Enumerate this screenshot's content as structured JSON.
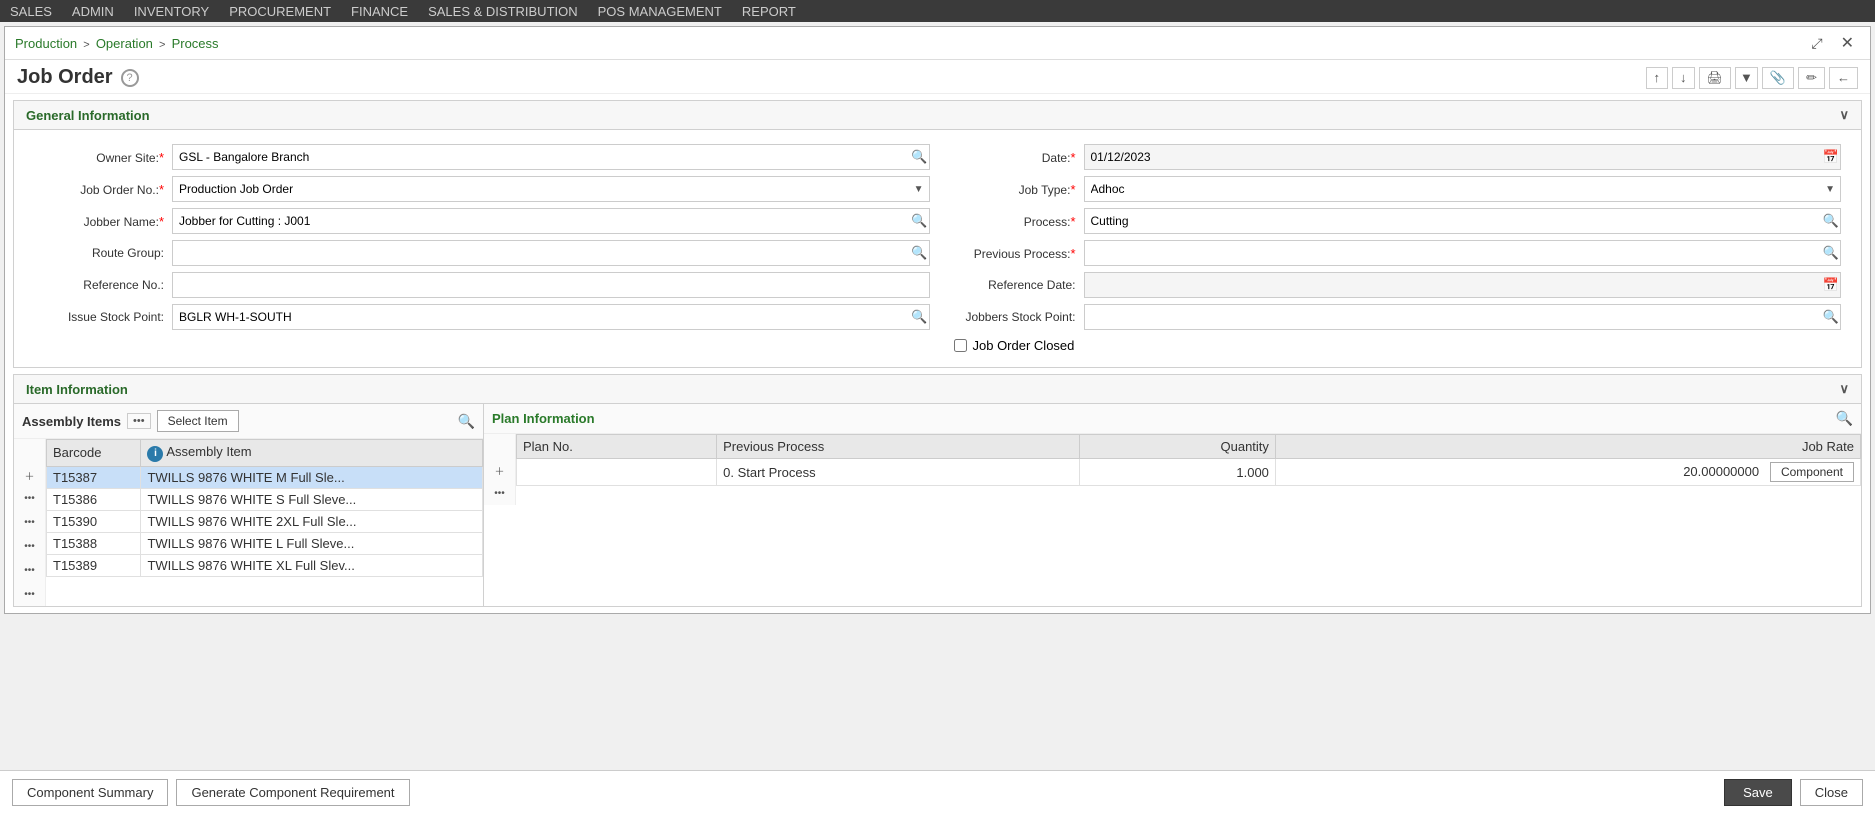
{
  "nav": {
    "items": [
      "SALES",
      "ADMIN",
      "INVENTORY",
      "PROCUREMENT",
      "FINANCE",
      "SALES & DISTRIBUTION",
      "POS MANAGEMENT",
      "REPORT"
    ]
  },
  "breadcrumb": {
    "parts": [
      "Production",
      "Operation",
      "Process"
    ]
  },
  "window": {
    "title": "Job Order",
    "page_title": "Production Job Order"
  },
  "toolbar": {
    "icons": [
      "↕",
      "↕",
      "🖨",
      "▼",
      "📎",
      "✏",
      "←"
    ]
  },
  "general_info": {
    "label": "General Information",
    "fields": {
      "owner_site": {
        "label": "Owner Site:",
        "value": "GSL - Bangalore Branch",
        "required": true
      },
      "job_order_no": {
        "label": "Job Order No.:",
        "value": "Production Job Order",
        "required": true
      },
      "jobber_name": {
        "label": "Jobber Name:",
        "value": "Jobber for Cutting : J001",
        "required": true
      },
      "route_group": {
        "label": "Route Group:",
        "value": "",
        "required": false
      },
      "reference_no": {
        "label": "Reference No.:",
        "value": "",
        "required": false
      },
      "issue_stock_point": {
        "label": "Issue Stock Point:",
        "value": "BGLR WH-1-SOUTH",
        "required": false
      },
      "date": {
        "label": "Date:",
        "value": "01/12/2023",
        "required": true
      },
      "job_type": {
        "label": "Job Type:",
        "value": "Adhoc",
        "required": true
      },
      "process": {
        "label": "Process:",
        "value": "Cutting",
        "required": true
      },
      "previous_process": {
        "label": "Previous Process:",
        "value": "",
        "required": true
      },
      "reference_date": {
        "label": "Reference Date:",
        "value": "",
        "required": false
      },
      "jobbers_stock_point": {
        "label": "Jobbers Stock Point:",
        "value": "",
        "required": false
      },
      "job_order_closed": {
        "label": "Job Order Closed",
        "checked": false
      }
    }
  },
  "item_info": {
    "label": "Item Information"
  },
  "assembly": {
    "title": "Assembly Items",
    "select_item_btn": "Select Item",
    "columns": [
      "Barcode",
      "Assembly Item"
    ],
    "rows": [
      {
        "barcode": "T15387",
        "item": "TWILLS 9876 WHITE M Full Sle...",
        "selected": true
      },
      {
        "barcode": "T15386",
        "item": "TWILLS 9876 WHITE S Full Sleve..."
      },
      {
        "barcode": "T15390",
        "item": "TWILLS 9876 WHITE 2XL Full Sle..."
      },
      {
        "barcode": "T15388",
        "item": "TWILLS 9876 WHITE L Full Sleve..."
      },
      {
        "barcode": "T15389",
        "item": "TWILLS 9876 WHITE XL Full Slev..."
      }
    ]
  },
  "plan": {
    "title": "Plan Information",
    "columns": [
      "Plan No.",
      "Previous Process",
      "Quantity",
      "Job Rate"
    ],
    "rows": [
      {
        "plan_no": "",
        "prev_process": "0. Start Process",
        "quantity": "1.000",
        "job_rate": "20.00000000",
        "component_btn": "Component"
      }
    ]
  },
  "footer": {
    "component_summary_btn": "Component Summary",
    "generate_btn": "Generate Component Requirement",
    "save_btn": "Save",
    "close_btn": "Close"
  }
}
